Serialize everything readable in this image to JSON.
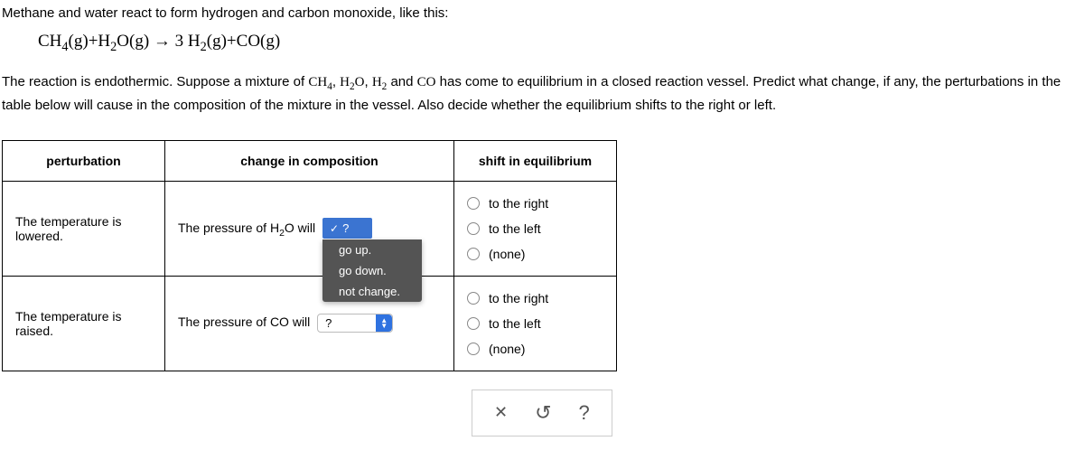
{
  "intro": "Methane and water react to form hydrogen and carbon monoxide, like this:",
  "equation_parts": {
    "r1": "CH",
    "r1s": "4",
    "r1p": "(g)",
    "plus1": "+",
    "r2": "H",
    "r2s": "2",
    "r2o": "O",
    "r2p": "(g)",
    "arrow": "→",
    "p1c": "3 H",
    "p1s": "2",
    "p1p": "(g)",
    "plus2": "+",
    "p2": "CO",
    "p2p": "(g)"
  },
  "paragraph_a": "The reaction is endothermic. Suppose a mixture of ",
  "paragraph_species": {
    "s1": "CH",
    "s1s": "4",
    "c1": ", ",
    "s2": "H",
    "s2s": "2",
    "s2o": "O",
    "c2": ", ",
    "s3": "H",
    "s3s": "2",
    "c3": " and ",
    "s4": "CO"
  },
  "paragraph_b": " has come to equilibrium in a closed reaction vessel. Predict what change, if any, the perturbations in the table below will cause in the composition of the mixture in the vessel. Also decide whether the equilibrium shifts to the right or left.",
  "headers": {
    "perturbation": "perturbation",
    "composition": "change in composition",
    "shift": "shift in equilibrium"
  },
  "rows": [
    {
      "perturbation": "The temperature is lowered.",
      "comp_label_a": "The pressure of H",
      "comp_label_sub": "2",
      "comp_label_b": "O will",
      "dropdown_open": true,
      "selected": "?",
      "options": [
        "go up.",
        "go down.",
        "not change."
      ]
    },
    {
      "perturbation": "The temperature is raised.",
      "comp_label_a": "The pressure of CO will",
      "comp_label_sub": "",
      "comp_label_b": "",
      "dropdown_open": false,
      "selected": "?",
      "options": []
    }
  ],
  "shift_options": [
    "to the right",
    "to the left",
    "(none)"
  ],
  "footer_icons": {
    "close": "✕",
    "reset": "↺",
    "help": "?"
  }
}
